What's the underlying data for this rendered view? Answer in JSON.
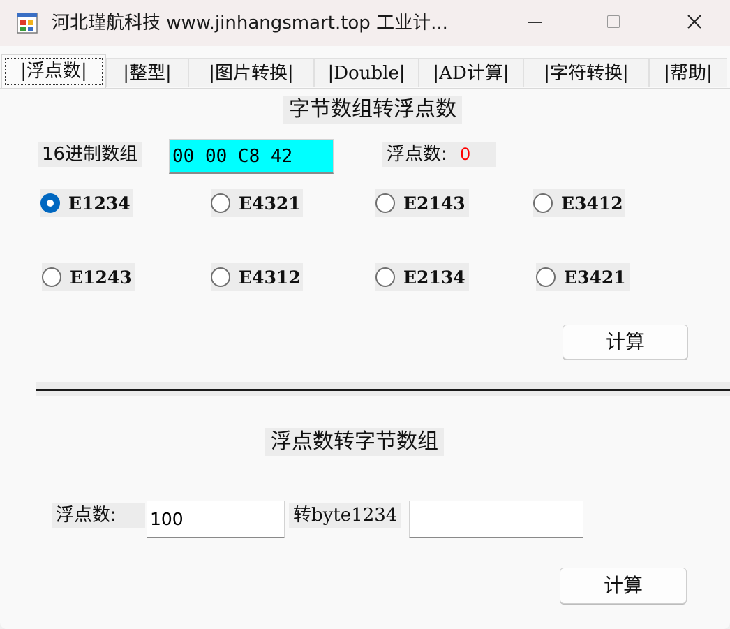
{
  "window": {
    "title": "河北瑾航科技 www.jinhangsmart.top 工业计..."
  },
  "tabs": [
    {
      "label": "|浮点数|"
    },
    {
      "label": "|整型|"
    },
    {
      "label": "|图片转换|"
    },
    {
      "label": "|Double|"
    },
    {
      "label": "|AD计算|"
    },
    {
      "label": "|字符转换|"
    },
    {
      "label": "|帮助|"
    }
  ],
  "bytes_to_float": {
    "title": "字节数组转浮点数",
    "hex_label": "16进制数组",
    "hex_value": "00 00 C8 42",
    "float_label": "浮点数:",
    "float_result": "0",
    "result_color": "#ff0000",
    "input_bg": "#00ffff",
    "byte_orders": [
      {
        "label": "E1234",
        "checked": true
      },
      {
        "label": "E4321",
        "checked": false
      },
      {
        "label": "E2143",
        "checked": false
      },
      {
        "label": "E3412",
        "checked": false
      },
      {
        "label": "E1243",
        "checked": false
      },
      {
        "label": "E4312",
        "checked": false
      },
      {
        "label": "E2134",
        "checked": false
      },
      {
        "label": "E3421",
        "checked": false
      }
    ],
    "calc_button": "计算"
  },
  "float_to_bytes": {
    "title": "浮点数转字节数组",
    "float_label": "浮点数:",
    "float_value": "100",
    "output_label": "转byte1234",
    "output_value": "",
    "calc_button": "计算"
  },
  "colors": {
    "radio_checked": "#0067c0"
  }
}
